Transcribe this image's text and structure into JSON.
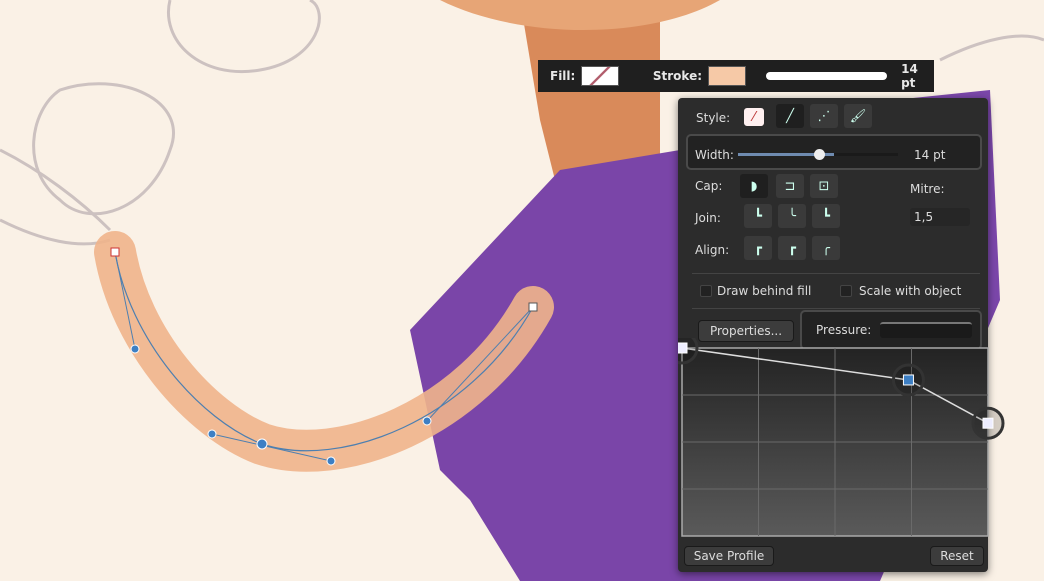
{
  "context_toolbar": {
    "fill_label": "Fill:",
    "stroke_label": "Stroke:",
    "width_value": "14 pt",
    "stroke_color": "#f6c9a7"
  },
  "stroke_panel": {
    "style_label": "Style:",
    "style_options": [
      "none-icon",
      "solid-line-icon",
      "dashed-line-icon",
      "brush-icon"
    ],
    "width_label": "Width:",
    "width_value": "14 pt",
    "width_fraction": 0.6,
    "cap_label": "Cap:",
    "join_label": "Join:",
    "align_label": "Align:",
    "mitre_label": "Mitre:",
    "mitre_value": "1,5",
    "draw_behind_fill": "Draw behind fill",
    "scale_with_object": "Scale with object",
    "properties_button": "Properties...",
    "pressure_label": "Pressure:",
    "save_profile_button": "Save Profile",
    "reset_button": "Reset",
    "pressure_curve": [
      [
        0,
        1.0
      ],
      [
        0.74,
        0.83
      ],
      [
        1.0,
        0.6
      ]
    ]
  },
  "colors": {
    "canvas": "#faf1e6",
    "shirt": "#7a45a8",
    "skin": "#e9a274",
    "panel": "#2c2c2c",
    "accent": "#3d7fc4"
  }
}
